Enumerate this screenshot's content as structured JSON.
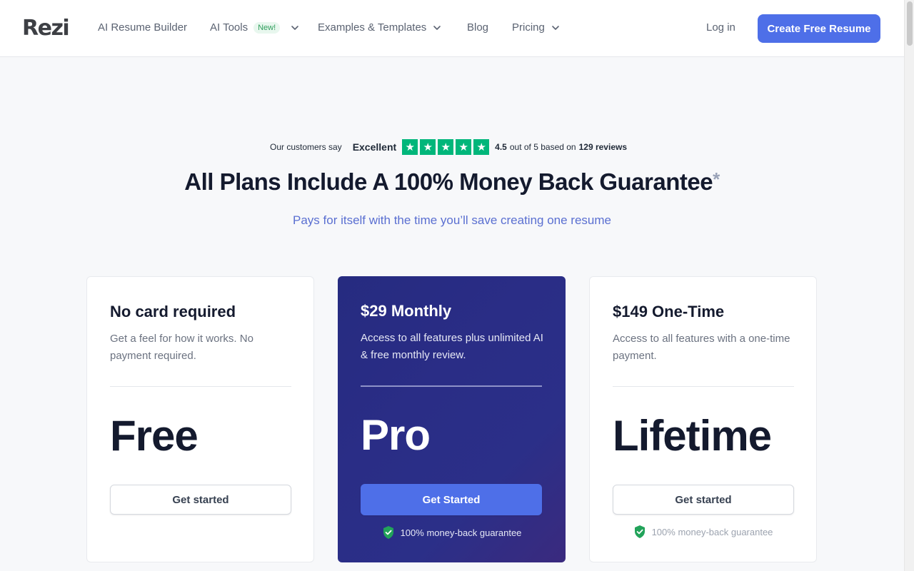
{
  "header": {
    "logo": "Rezi",
    "nav": [
      {
        "label": "AI Resume Builder"
      },
      {
        "label": "AI Tools",
        "badge": "New!"
      },
      {
        "label": "Examples & Templates"
      },
      {
        "label": "Blog"
      },
      {
        "label": "Pricing"
      }
    ],
    "login": "Log in",
    "cta": "Create Free Resume"
  },
  "reviews": {
    "say": "Our customers say",
    "rating_word": "Excellent",
    "star_count": 5,
    "score": "4.5",
    "out_of": "out of 5 based on",
    "count": "129 reviews"
  },
  "hero": {
    "title": "All Plans Include A 100% Money Back Guarantee",
    "asterisk": "*",
    "subtitle": "Pays for itself with the time you’ll save creating one resume"
  },
  "plans": [
    {
      "name": "No card required",
      "desc": "Get a feel for how it works. No payment required.",
      "plan": "Free",
      "button": "Get started"
    },
    {
      "name": "$29 Monthly",
      "desc": "Access to all features plus unlimited AI & free monthly review.",
      "plan": "Pro",
      "button": "Get Started",
      "guarantee": "100% money-back guarantee"
    },
    {
      "name": "$149 One-Time",
      "desc": "Access to all features with a one-time payment.",
      "plan": "Lifetime",
      "button": "Get started",
      "guarantee": "100% money-back guarantee"
    }
  ],
  "colors": {
    "accent": "#4e6fe8",
    "trustpilot_green": "#00b67a",
    "shield_green": "#22a35a",
    "pro_card": "#2a2d86"
  },
  "icons": {
    "star": "star-icon",
    "chevron": "chevron-down-icon",
    "shield": "shield-check-icon"
  }
}
